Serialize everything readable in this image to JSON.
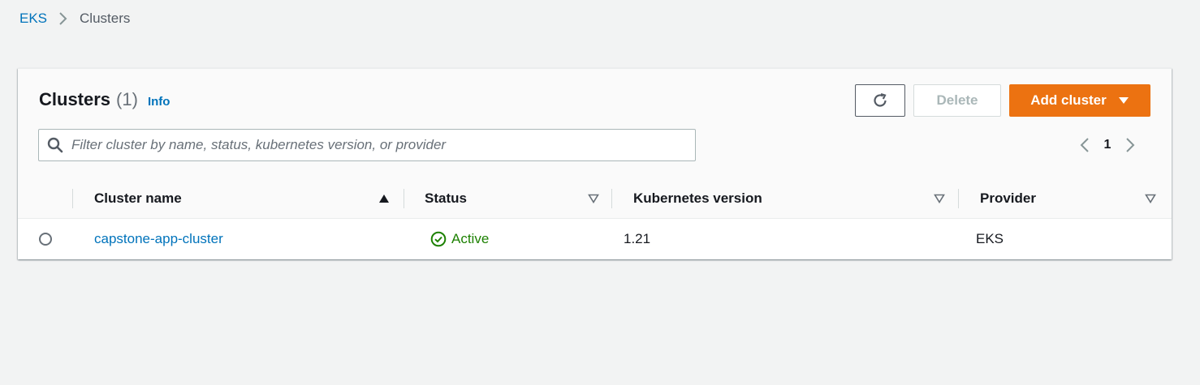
{
  "breadcrumb": {
    "items": [
      {
        "label": "EKS",
        "icon": "chevron-right-icon"
      },
      {
        "label": "Clusters"
      }
    ]
  },
  "panel": {
    "title": "Clusters",
    "count": "(1)",
    "info_label": "Info",
    "refresh_icon": "refresh-icon",
    "delete_label": "Delete",
    "add_label": "Add cluster",
    "add_icon": "caret-down-icon",
    "search": {
      "placeholder": "Filter cluster by name, status, kubernetes version, or provider",
      "value": "",
      "icon": "search-icon"
    },
    "pagination": {
      "current_page": "1",
      "prev_icon": "chevron-left-icon",
      "next_icon": "chevron-right-icon"
    }
  },
  "table": {
    "columns": [
      {
        "label": "Cluster name",
        "sort": "ascending"
      },
      {
        "label": "Status",
        "sort": "none"
      },
      {
        "label": "Kubernetes version",
        "sort": "none"
      },
      {
        "label": "Provider",
        "sort": "none"
      }
    ],
    "rows": [
      {
        "selected": false,
        "name": "capstone-app-cluster",
        "status": "Active",
        "status_icon": "check-circle-icon",
        "version": "1.21",
        "provider": "EKS"
      }
    ]
  },
  "colors": {
    "accent_orange": "#ec7211",
    "link_blue": "#0073bb",
    "status_green": "#1d8102",
    "background": "#f2f3f3"
  }
}
